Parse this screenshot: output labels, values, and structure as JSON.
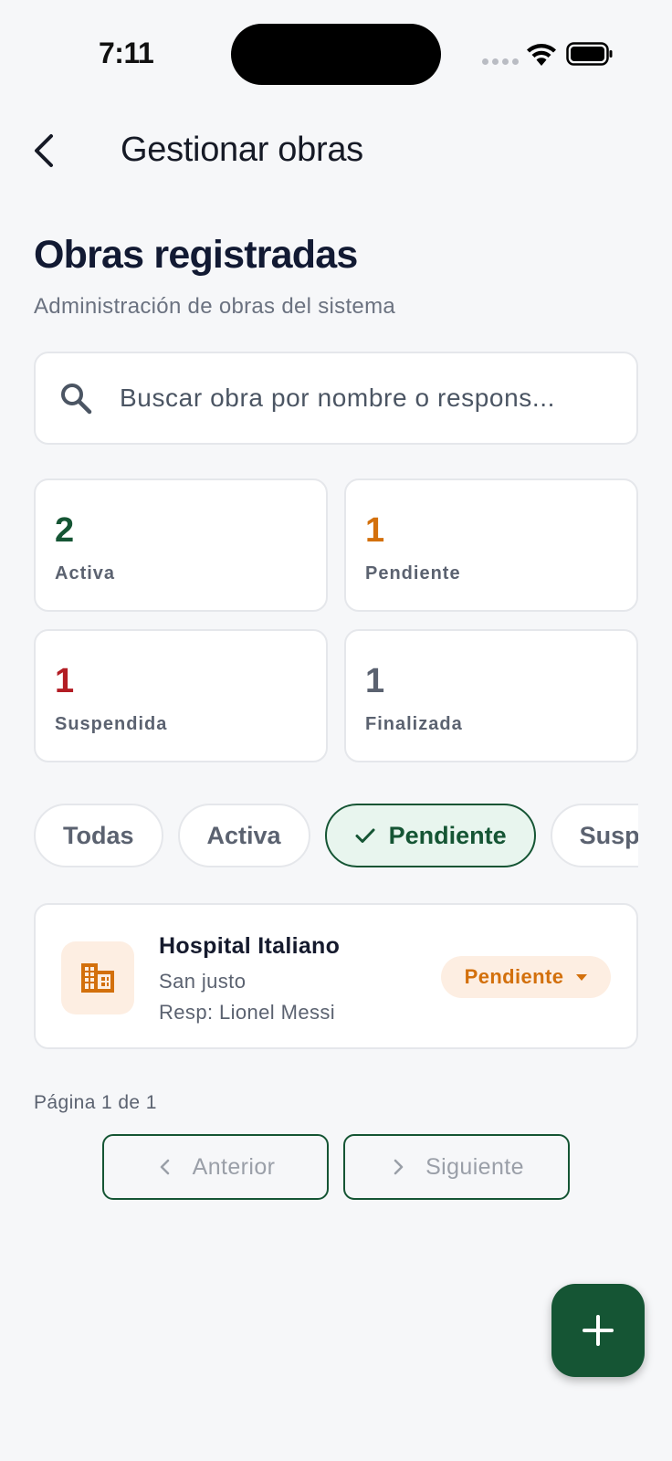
{
  "status_bar": {
    "time": "7:11"
  },
  "app_bar": {
    "title": "Gestionar obras"
  },
  "header": {
    "title": "Obras registradas",
    "subtitle": "Administración de obras del sistema"
  },
  "search": {
    "placeholder": "Buscar obra por nombre o respons..."
  },
  "stats": [
    {
      "value": "2",
      "label": "Activa",
      "color": "#155534"
    },
    {
      "value": "1",
      "label": "Pendiente",
      "color": "#d3700c"
    },
    {
      "value": "1",
      "label": "Suspendida",
      "color": "#b31d24"
    },
    {
      "value": "1",
      "label": "Finalizada",
      "color": "#5b6270"
    }
  ],
  "filters": [
    {
      "label": "Todas",
      "selected": false
    },
    {
      "label": "Activa",
      "selected": false
    },
    {
      "label": "Pendiente",
      "selected": true
    },
    {
      "label": "Suspendida",
      "selected": false
    }
  ],
  "obras": [
    {
      "name": "Hospital Italiano",
      "location": "San justo",
      "responsible": "Resp: Lionel Messi",
      "status": "Pendiente",
      "icon": "building-icon"
    }
  ],
  "pagination": {
    "info": "Página 1 de 1",
    "prev_label": "Anterior",
    "next_label": "Siguiente"
  },
  "fab": {
    "icon": "plus-icon"
  },
  "colors": {
    "primary": "#155534",
    "pending": "#d3700c",
    "pending_bg": "#fdeee2",
    "suspended": "#b31d24",
    "finished": "#5b6270"
  }
}
